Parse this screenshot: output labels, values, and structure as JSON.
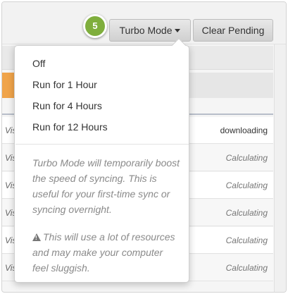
{
  "step_badge": "5",
  "toolbar": {
    "turbo_label": "Turbo Mode",
    "clear_label": "Clear Pending"
  },
  "turbo_menu": {
    "items": [
      {
        "label": "Off"
      },
      {
        "label": "Run for 1 Hour"
      },
      {
        "label": "Run for 4 Hours"
      },
      {
        "label": "Run for 12 Hours"
      }
    ],
    "info_text": "Turbo Mode will temporarily boost the speed of syncing. This is useful for your first-time sync or syncing overnight.",
    "warning_text": "This will use a lot of resources and may make your computer feel sluggish.",
    "warning_icon": "warning-triangle-icon"
  },
  "rows": [
    {
      "prefix": "Vis",
      "status": "downloading"
    },
    {
      "prefix": "Vis",
      "status": "Calculating"
    },
    {
      "prefix": "Vis",
      "status": "Calculating"
    },
    {
      "prefix": "Vis",
      "status": "Calculating"
    },
    {
      "prefix": "Vis",
      "status": "Calculating"
    },
    {
      "prefix": "Vis",
      "status": "Calculating"
    }
  ],
  "colors": {
    "badge": "#7fae3d",
    "accent_bar": "#f0a44a"
  }
}
